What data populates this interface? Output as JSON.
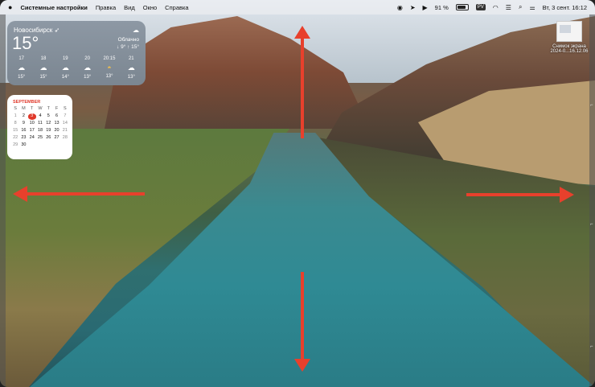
{
  "menubar": {
    "apple_icon": "apple-icon",
    "app_name": "Системные настройки",
    "menus": [
      "Правка",
      "Вид",
      "Окно",
      "Справка"
    ],
    "battery": "91 %",
    "input_source": "PV",
    "datetime": "Вт, 3 сент.  16:12"
  },
  "weather": {
    "city": "Новосибирск",
    "temperature": "15°",
    "condition": "Облачно",
    "hilo": "↓ 9° ↑ 15°",
    "hours": [
      {
        "time": "17",
        "icon": "cloud-icon",
        "temp": "15°"
      },
      {
        "time": "18",
        "icon": "cloud-icon",
        "temp": "15°"
      },
      {
        "time": "19",
        "icon": "cloud-icon",
        "temp": "14°"
      },
      {
        "time": "20",
        "icon": "cloud-icon",
        "temp": "13°"
      },
      {
        "time": "20:15",
        "icon": "sunset-icon",
        "temp": "13°"
      },
      {
        "time": "21",
        "icon": "cloud-icon",
        "temp": "13°"
      }
    ]
  },
  "calendar": {
    "month": "SEPTEMBER",
    "weekdays": [
      "S",
      "M",
      "T",
      "W",
      "T",
      "F",
      "S"
    ],
    "days": [
      "1",
      "2",
      "3",
      "4",
      "5",
      "6",
      "7",
      "8",
      "9",
      "10",
      "11",
      "12",
      "13",
      "14",
      "15",
      "16",
      "17",
      "18",
      "19",
      "20",
      "21",
      "22",
      "23",
      "24",
      "25",
      "26",
      "27",
      "28",
      "29",
      "30"
    ],
    "first_weekday_offset": 0,
    "today": "3"
  },
  "desktop_file": {
    "name_line1": "Снимок экрана",
    "name_line2": "2024-0...16.12.06"
  },
  "colors": {
    "arrow": "#e8402c",
    "calendar_accent": "#e0392b"
  }
}
